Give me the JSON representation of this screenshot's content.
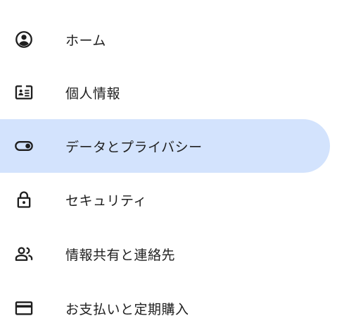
{
  "sidebar": {
    "items": [
      {
        "label": "ホーム",
        "icon": "account-circle-icon",
        "active": false
      },
      {
        "label": "個人情報",
        "icon": "id-card-icon",
        "active": false
      },
      {
        "label": "データとプライバシー",
        "icon": "toggle-icon",
        "active": true
      },
      {
        "label": "セキュリティ",
        "icon": "lock-icon",
        "active": false
      },
      {
        "label": "情報共有と連絡先",
        "icon": "people-icon",
        "active": false
      },
      {
        "label": "お支払いと定期購入",
        "icon": "credit-card-icon",
        "active": false
      }
    ]
  },
  "colors": {
    "active_background": "#d3e3fd",
    "text": "#1f1f1f",
    "icon": "#1f1f1f"
  }
}
